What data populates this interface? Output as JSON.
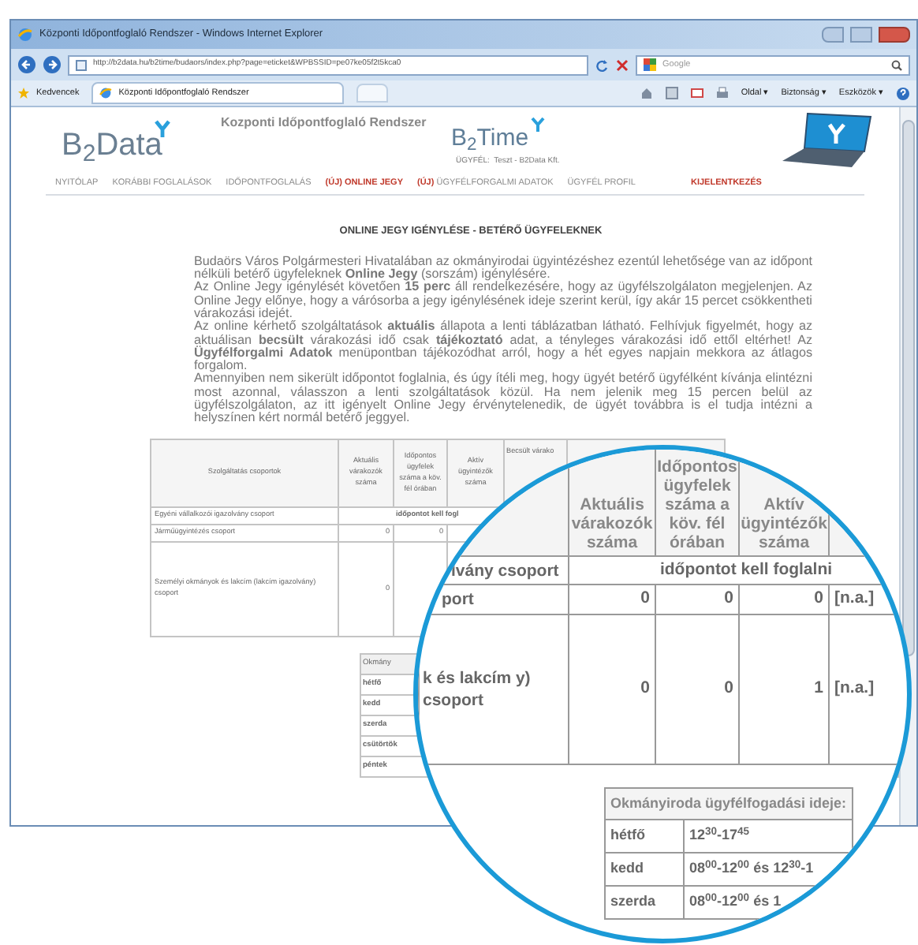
{
  "window": {
    "title": "Központi Időpontfoglaló Rendszer - Windows Internet Explorer"
  },
  "browser": {
    "address": "http://b2data.hu/b2time/budaors/index.php?page=eticket&WPBSSID=pe07ke05f2t5kca0",
    "search_placeholder": "Google",
    "favorites": "Kedvencek",
    "tab": "Központi Időpontfoglaló Rendszer",
    "menus": [
      "Oldal ▾",
      "Biztonság ▾",
      "Eszközök ▾"
    ]
  },
  "header": {
    "logo": "B$_{2}$Data",
    "system_title": "Kozponti Időpontfoglaló Rendszer",
    "product_logo": "B$_{2}$Time",
    "client": "ÜGYFÉL:  Teszt - B2Data Kft."
  },
  "nav": [
    {
      "label": "NYITÓLAP",
      "highlight": false
    },
    {
      "label": "KORÁBBI FOGLALÁSOK",
      "highlight": false
    },
    {
      "label": "IDŐPONTFOGLALÁS",
      "highlight": false
    },
    {
      "badge": "(ÚJ)",
      "label": "ONLINE JEGY",
      "highlight": true
    },
    {
      "badge": "(ÚJ)",
      "label": "ÜGYFÉLFORGALMI ADATOK",
      "highlight": false
    },
    {
      "label": "ÜGYFÉL PROFIL",
      "highlight": false
    },
    {
      "label": "KIJELENTKEZÉS",
      "highlight": true
    }
  ],
  "heading": "ONLINE JEGY IGÉNYLÉSE - BETÉRŐ ÜGYFELEKNEK",
  "paragraphs": [
    "Budaörs Város Polgármesteri Hivatalában az okmányirodai ügyintézéshez ezentúl lehetősége van az időpont nélküli betérő ügyfeleknek **Online Jegy** (sorszám) igénylésére.",
    "Az Online Jegy igénylését követően **15 perc** áll rendelkezésére, hogy az ügyfélszolgálaton megjelenjen. Az Online Jegy előnye, hogy a várósorba a jegy igénylésének ideje szerint kerül, így akár 15 percet csökkentheti várakozási idejét.",
    "Az online kérhető szolgáltatások **aktuális** állapota a lenti táblázatban látható. Felhívjuk figyelmét, hogy az aktuálisan **becsült** várakozási idő csak **tájékoztató** adat, a tényleges várakozási idő ettől eltérhet! Az **Ügyfélforgalmi Adatok** menüpontban tájékozódhat arról, hogy a hét egyes napjain mekkora az átlagos forgalom.",
    "Amennyiben nem sikerült időpontot foglalnia, és úgy ítéli meg, hogy ügyét betérő ügyfélként kívánja elintézni most azonnal, válasszon a lenti szolgáltatások közül. Ha nem jelenik meg 15 percen belül az ügyfélszolgálaton, az itt igényelt Online Jegy érvénytelenedik, de ügyét továbbra is el tudja intézni a helyszínen kért normál betérő jeggyel."
  ],
  "services_table": {
    "columns": [
      "Szolgáltatás csoportok",
      "Aktuális várakozók száma",
      "Időpontos ügyfelek száma a köv. fél órában",
      "Aktív ügyintézők száma",
      "Becsült várako"
    ],
    "rows": [
      {
        "kind": "notice",
        "name": "Egyéni vállalkozói igazolvány csoport",
        "notice": "időpontot kell fogl"
      },
      {
        "kind": "values",
        "name": "Járműügyintézés csoport",
        "cells": [
          "0",
          "0"
        ]
      },
      {
        "kind": "values",
        "name": "Személyi okmányok és lakcím (lakcím igazolvány) csoport",
        "cells": [
          "0"
        ]
      }
    ]
  },
  "hours_table": {
    "header": "Okmány",
    "days": [
      "hétfő",
      "kedd",
      "szerda",
      "csütörtök",
      "péntek"
    ]
  },
  "magnifier": {
    "columns": [
      "Aktuális várakozók száma",
      "Időpontos ügyfelek száma a köv. fél órában",
      "Aktív ügyintézők száma"
    ],
    "rows": [
      {
        "kind": "notice",
        "name": "lvány csoport",
        "notice": "időpontot kell foglalni"
      },
      {
        "kind": "values",
        "name": "port",
        "cells": [
          "0",
          "0",
          "0",
          "[n.a.]"
        ]
      },
      {
        "kind": "values",
        "name": "k és lakcím y) csoport",
        "cells": [
          "0",
          "0",
          "1",
          "[n.a.]"
        ]
      }
    ],
    "hours": {
      "header": "Okmányiroda ügyfélfogadási ideje:",
      "rows": [
        {
          "day": "hétfő",
          "time": "12$^{30}$-17$^{45}$"
        },
        {
          "day": "kedd",
          "time": "08$^{00}$-12$^{00}$ és 12$^{30}$-1"
        },
        {
          "day": "szerda",
          "time": "08$^{00}$-12$^{00}$ és 1"
        }
      ]
    }
  }
}
